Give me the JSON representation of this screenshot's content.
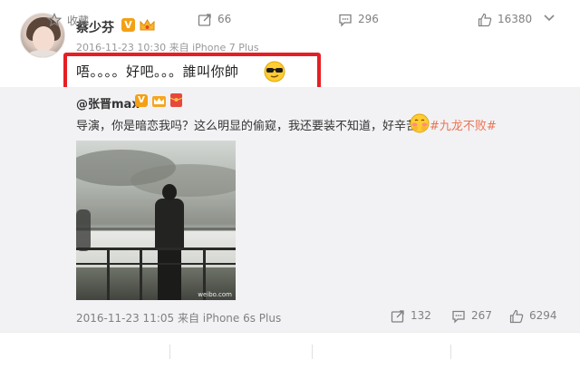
{
  "author": {
    "name": "蔡少芬",
    "verified_badge": "V",
    "avatar_icon": "avatar-photo"
  },
  "post": {
    "meta": "2016-11-23 10:30 来自 iPhone 7 Plus",
    "text": "唔。。。。好吧。。。誰叫你帥",
    "highlight_color": "#e51f23",
    "emoji": "cool-sunglasses-emoji"
  },
  "repost": {
    "user": "@张晋max",
    "verified_badge": "V",
    "text": "导演，你是暗恋我吗？这么明显的偷窥，我还要装不知道，好辛苦",
    "emoji": "shy-emoji",
    "topic": "#九龙不败#",
    "topic_color": "#eb7350",
    "photo_watermark": "weibo.com",
    "meta": "2016-11-23 11:05 来自 iPhone 6s Plus",
    "actions": {
      "forward": "132",
      "comment": "267",
      "like": "6294"
    }
  },
  "footer": {
    "favorite_label": "收藏",
    "forward_count": "66",
    "comment_count": "296",
    "like_count": "16380"
  },
  "colors": {
    "repost_bg": "#f2f2f5",
    "badge": "#f4a014",
    "muted_text": "#808080"
  }
}
